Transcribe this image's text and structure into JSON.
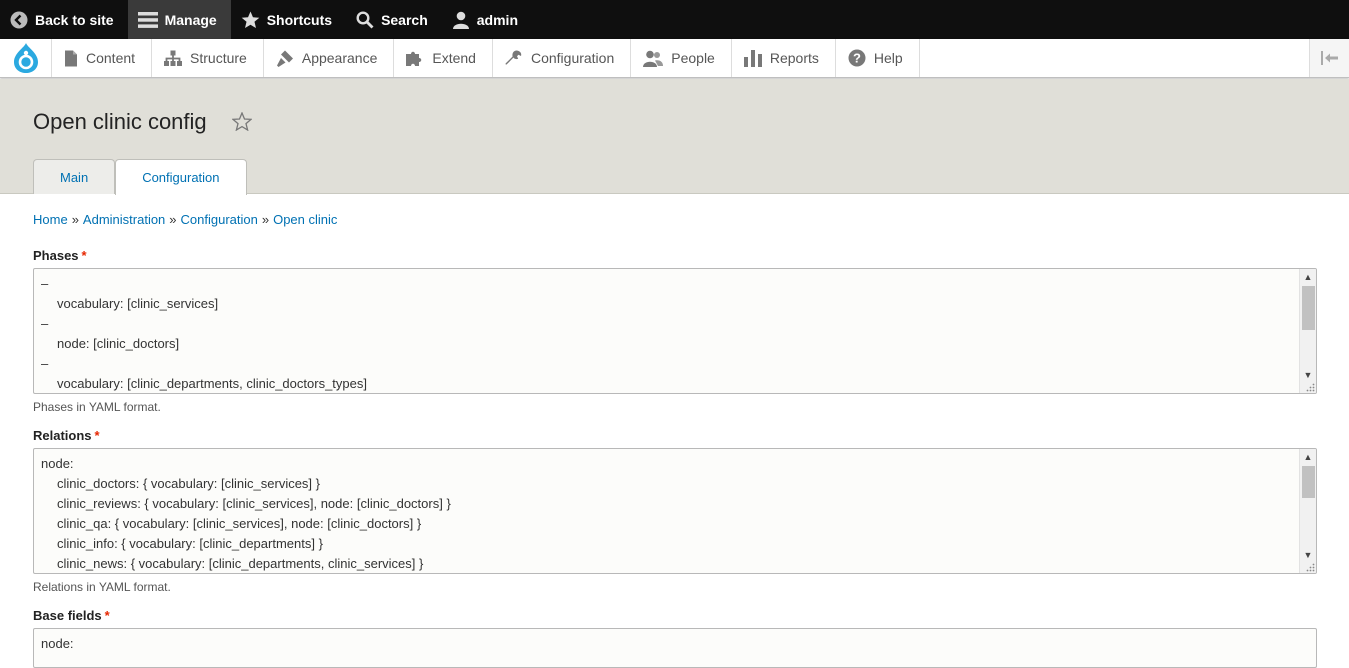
{
  "toolbar": {
    "back_to_site": "Back to site",
    "manage": "Manage",
    "shortcuts": "Shortcuts",
    "search": "Search",
    "user": "admin"
  },
  "tray": {
    "items": [
      {
        "label": "Content",
        "icon": "document-icon"
      },
      {
        "label": "Structure",
        "icon": "sitemap-icon"
      },
      {
        "label": "Appearance",
        "icon": "paint-icon"
      },
      {
        "label": "Extend",
        "icon": "puzzle-icon"
      },
      {
        "label": "Configuration",
        "icon": "wrench-icon"
      },
      {
        "label": "People",
        "icon": "people-icon"
      },
      {
        "label": "Reports",
        "icon": "bar-chart-icon"
      },
      {
        "label": "Help",
        "icon": "help-icon"
      }
    ]
  },
  "page": {
    "title": "Open clinic config",
    "tabs": [
      {
        "label": "Main",
        "active": false
      },
      {
        "label": "Configuration",
        "active": true
      }
    ]
  },
  "breadcrumb": [
    "Home",
    "Administration",
    "Configuration",
    "Open clinic"
  ],
  "breadcrumb_separator": "»",
  "fields": {
    "phases": {
      "label": "Phases",
      "required_mark": "*",
      "lines": [
        "–",
        "vocabulary: [clinic_services]",
        "–",
        "node: [clinic_doctors]",
        "–",
        "vocabulary: [clinic_departments, clinic_doctors_types]"
      ],
      "description": "Phases in YAML format."
    },
    "relations": {
      "label": "Relations",
      "required_mark": "*",
      "lines": [
        "node:",
        "clinic_doctors: { vocabulary: [clinic_services] }",
        "clinic_reviews: { vocabulary: [clinic_services], node: [clinic_doctors] }",
        "clinic_qa: { vocabulary: [clinic_services], node: [clinic_doctors] }",
        "clinic_info: { vocabulary: [clinic_departments] }",
        "clinic_news: { vocabulary: [clinic_departments, clinic_services] }"
      ],
      "description": "Relations in YAML format."
    },
    "base_fields": {
      "label": "Base fields",
      "required_mark": "*",
      "lines": [
        "node:"
      ]
    }
  },
  "colors": {
    "toolbar_bg": "#0f0f0f",
    "link": "#0071b3",
    "required": "#e62600",
    "header_bg": "#e0dfd8",
    "drupal_blue": "#2ba9e0"
  }
}
